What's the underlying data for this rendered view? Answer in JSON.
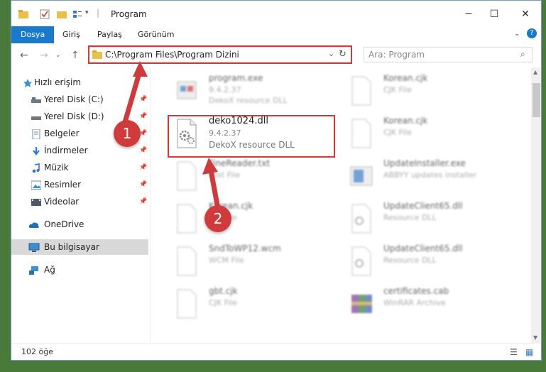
{
  "window": {
    "title": "Program"
  },
  "ribbon": {
    "tabs": [
      "Dosya",
      "Giriş",
      "Paylaş",
      "Görünüm"
    ]
  },
  "nav": {
    "address": "C:\\Program Files\\Program Dizini",
    "search_placeholder": "Ara: Program"
  },
  "sidebar": {
    "items": [
      {
        "label": "Hızlı erişim"
      },
      {
        "label": "Yerel Disk (C:)"
      },
      {
        "label": "Yerel Disk (D:)"
      },
      {
        "label": "Belgeler"
      },
      {
        "label": "İndirmeler"
      },
      {
        "label": "Müzik"
      },
      {
        "label": "Resimler"
      },
      {
        "label": "Videolar"
      },
      {
        "label": "OneDrive"
      },
      {
        "label": "Bu bilgisayar"
      },
      {
        "label": "Ağ"
      }
    ]
  },
  "files": {
    "left": [
      {
        "name": "program.exe",
        "line2": "9.4.2.37",
        "line3": "DekoX resource DLL"
      },
      {
        "name": "deko1024.dll",
        "line2": "9.4.2.37",
        "line3": "DekoX resource DLL"
      },
      {
        "name": "FineReader.txt",
        "line2": "Text File",
        "line3": ""
      },
      {
        "name": "Korean.cjk",
        "line2": "CJK File",
        "line3": ""
      },
      {
        "name": "SndToWP12.wcm",
        "line2": "WCM File",
        "line3": ""
      },
      {
        "name": "gbt.cjk",
        "line2": "CJK File",
        "line3": ""
      }
    ],
    "right": [
      {
        "name": "Korean.cjk",
        "line2": "CJK File"
      },
      {
        "name": "Korean.cjk",
        "line2": "CJK File"
      },
      {
        "name": "UpdateInstaller.exe",
        "line2": "ABBYY updates installer"
      },
      {
        "name": "UpdateClient65.dll",
        "line2": "Resource DLL"
      },
      {
        "name": "UpdateClient65.dll",
        "line2": "Resource DLL"
      },
      {
        "name": "certificates.cab",
        "line2": "WinRAR Archive"
      }
    ]
  },
  "status": {
    "count": "102 öğe"
  },
  "annotations": {
    "badge1": "1",
    "badge2": "2"
  },
  "colors": {
    "accent": "#1979ca",
    "highlight": "#d13a3a"
  }
}
